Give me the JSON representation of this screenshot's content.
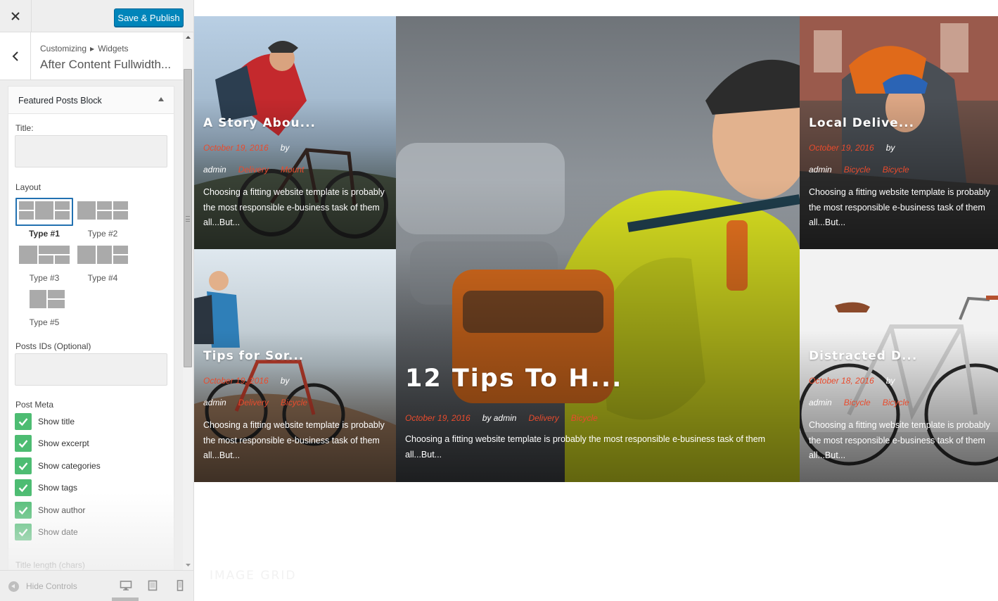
{
  "topbar": {
    "close_icon": "close-icon",
    "publish_label": "Save & Publish",
    "accent_color": "#0085ba"
  },
  "panel": {
    "breadcrumb_root": "Customizing",
    "breadcrumb_current": "Widgets",
    "title": "After Content Fullwidth..."
  },
  "widget": {
    "name": "Featured Posts Block",
    "title_label": "Title:",
    "title_value": "",
    "layout_label": "Layout",
    "layouts": [
      {
        "label": "Type #1",
        "selected": true
      },
      {
        "label": "Type #2",
        "selected": false
      },
      {
        "label": "Type #3",
        "selected": false
      },
      {
        "label": "Type #4",
        "selected": false
      },
      {
        "label": "Type #5",
        "selected": false
      }
    ],
    "post_ids_label": "Posts IDs (Optional)",
    "post_ids_value": "",
    "post_meta_label": "Post Meta",
    "checkboxes": [
      {
        "label": "Show title",
        "checked": true
      },
      {
        "label": "Show excerpt",
        "checked": true
      },
      {
        "label": "Show categories",
        "checked": true
      },
      {
        "label": "Show tags",
        "checked": true
      },
      {
        "label": "Show author",
        "checked": true
      },
      {
        "label": "Show date",
        "checked": true
      }
    ],
    "title_length_label": "Title length (chars)",
    "checkbox_color": "#4dbc72"
  },
  "footer": {
    "hide_controls_label": "Hide Controls",
    "devices": [
      "desktop-icon",
      "tablet-icon",
      "mobile-icon"
    ]
  },
  "preview": {
    "meta_accent_color": "#e94b2d",
    "posts": [
      {
        "title": "A Story Abou...",
        "date": "October 19, 2016",
        "author": "by admin",
        "categories": [
          "Delivery",
          "Mount"
        ],
        "excerpt": "Choosing a fitting website template is probably the most responsible e-business task of them all...But..."
      },
      {
        "title": "12 Tips To H...",
        "date": "October 19, 2016",
        "author": "by admin",
        "categories": [
          "Delivery",
          "Bicycle"
        ],
        "excerpt": "Choosing a fitting website template is probably the most responsible e-business task of them all...But..."
      },
      {
        "title": "Local Delive...",
        "date": "October 19, 2016",
        "author": "by admin",
        "categories": [
          "Bicycle",
          "Bicycle"
        ],
        "excerpt": "Choosing a fitting website template is probably the most responsible e-business task of them all...But..."
      },
      {
        "title": "Tips for Sor...",
        "date": "October 19, 2016",
        "author": "by admin",
        "categories": [
          "Delivery",
          "Bicycle"
        ],
        "excerpt": "Choosing a fitting website template is probably the most responsible e-business task of them all...But..."
      },
      {
        "title": "Distracted D...",
        "date": "October 18, 2016",
        "author": "by admin",
        "categories": [
          "Bicycle",
          "Bicycle"
        ],
        "excerpt": "Choosing a fitting website template is probably the most responsible e-business task of them all...But..."
      }
    ],
    "section_title": "IMAGE GRID"
  }
}
